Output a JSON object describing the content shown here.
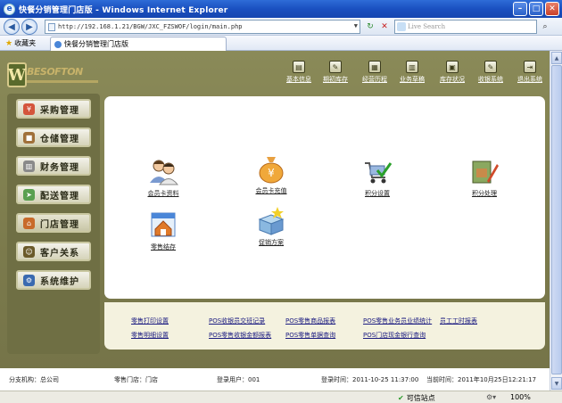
{
  "window": {
    "title": "快餐分销管理门店版 - Windows Internet Explorer"
  },
  "browser": {
    "url": "http://192.168.1.21/BGW/JXC_FZSWOF/login/main.php",
    "search_placeholder": "Live Search",
    "favorites_label": "收藏夹",
    "tab_title": "快餐分销管理门店版",
    "status_zone": "可信站点",
    "zoom": "100%"
  },
  "app": {
    "logo_letter": "W",
    "logo_text": "BESOFTON"
  },
  "topnav": [
    {
      "label": "基本信息"
    },
    {
      "label": "期初库存"
    },
    {
      "label": "经营历程"
    },
    {
      "label": "业务草稿"
    },
    {
      "label": "库存状况"
    },
    {
      "label": "收银系统"
    },
    {
      "label": "退出系统"
    }
  ],
  "sidemenu": [
    {
      "label": "采购管理"
    },
    {
      "label": "仓储管理"
    },
    {
      "label": "财务管理"
    },
    {
      "label": "配送管理"
    },
    {
      "label": "门店管理"
    },
    {
      "label": "客户关系"
    },
    {
      "label": "系统维护"
    }
  ],
  "content_icons": [
    {
      "label": "会员卡资料",
      "icon": "users-icon"
    },
    {
      "label": "会员卡充值",
      "icon": "money-bag-icon"
    },
    {
      "label": "积分设置",
      "icon": "cart-check-icon"
    },
    {
      "label": "积分处理",
      "icon": "box-pen-icon"
    },
    {
      "label": "零售结存",
      "icon": "house-calendar-icon"
    },
    {
      "label": "促销方案",
      "icon": "promo-box-icon"
    }
  ],
  "quick_links": [
    {
      "label": "零售打印设置"
    },
    {
      "label": "POS收银员交班记录"
    },
    {
      "label": "POS零售商品报表"
    },
    {
      "label": "POS零售业务员业绩统计"
    },
    {
      "label": "员工工时报表"
    },
    {
      "label": "零售明细设置"
    },
    {
      "label": "POS零售收银金额报表"
    },
    {
      "label": "POS零售单据查询"
    },
    {
      "label": "POS门店现金银行查询"
    }
  ],
  "footer": {
    "branch": "分支机构：总公司",
    "store": "零售门店：门店",
    "user": "登录用户：001",
    "login_time": "登录时间：2011-10-25 11:37:00",
    "current_time": "当前时间：2011年10月25日12:21:17"
  },
  "colors": {
    "frame": "#7f7f54",
    "titlebar": "#1a50c0"
  }
}
